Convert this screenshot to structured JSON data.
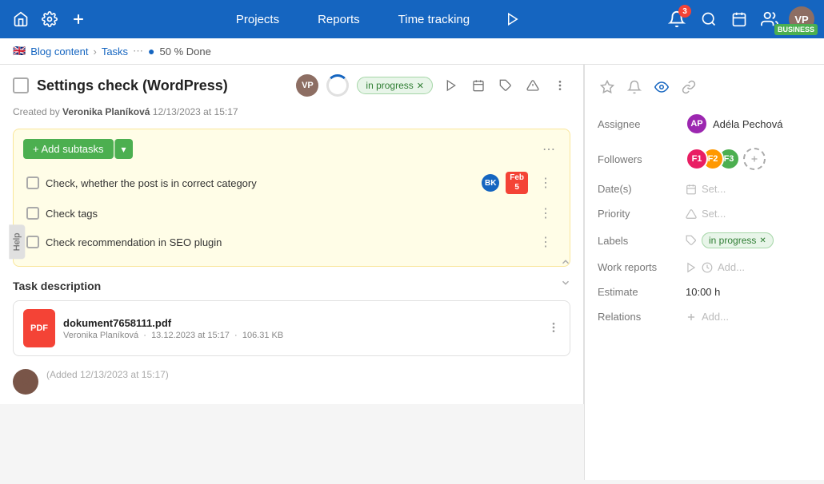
{
  "topnav": {
    "logo_icon": "home",
    "settings_icon": "gear",
    "add_icon": "plus",
    "nav_links": [
      "Projects",
      "Reports",
      "Time tracking"
    ],
    "play_icon": "play",
    "notification_count": "3",
    "search_icon": "search",
    "calendar_icon": "calendar",
    "people_icon": "people",
    "business_label": "BUSINESS"
  },
  "breadcrumb": {
    "flag": "🇬🇧",
    "project": "Blog content",
    "section": "Tasks",
    "progress_percent": "50",
    "progress_label": "50 % Done"
  },
  "task": {
    "title": "Settings check (WordPress)",
    "status": "in progress",
    "created_by_label": "Created by",
    "created_by_name": "Veronika Planíková",
    "created_at": "12/13/2023 at 15:17"
  },
  "subtasks": {
    "add_label": "+ Add subtasks",
    "items": [
      {
        "label": "Check, whether the post is in correct category",
        "assignee_initials": "BK",
        "assignee_bg": "#1565c0",
        "due_month": "Feb",
        "due_day": "5"
      },
      {
        "label": "Check tags",
        "assignee_initials": "",
        "due_month": "",
        "due_day": ""
      },
      {
        "label": "Check recommendation in SEO plugin",
        "assignee_initials": "",
        "due_month": "",
        "due_day": ""
      }
    ]
  },
  "description": {
    "title": "Task description",
    "attachment": {
      "name": "dokument7658111.pdf",
      "author": "Veronika Planíková",
      "date": "13.12.2023 at 15:17",
      "size": "106.31 KB",
      "icon_label": "PDF"
    }
  },
  "comment": {
    "added_label": "(Added 12/13/2023 at 15:17)"
  },
  "right_panel": {
    "assignee_label": "Assignee",
    "assignee_name": "Adéla Pechová",
    "followers_label": "Followers",
    "dates_label": "Date(s)",
    "dates_placeholder": "Set...",
    "priority_label": "Priority",
    "priority_placeholder": "Set...",
    "labels_label": "Labels",
    "labels_value": "in progress",
    "work_reports_label": "Work reports",
    "work_reports_placeholder": "Add...",
    "estimate_label": "Estimate",
    "estimate_value": "10:00 h",
    "relations_label": "Relations",
    "relations_placeholder": "Add..."
  },
  "help": {
    "label": "Help"
  }
}
